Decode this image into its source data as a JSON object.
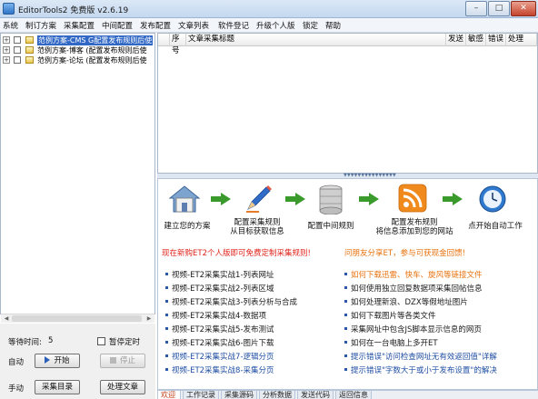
{
  "window": {
    "title": "EditorTools2 免费版 v2.6.19",
    "minimize_label": "–",
    "maximize_label": "□",
    "close_label": "✕"
  },
  "menu": [
    "系统",
    "制订方案",
    "采集配置",
    "中间配置",
    "发布配置",
    "文章列表",
    "软件登记",
    "升级个人版",
    "锁定",
    "帮助"
  ],
  "tree": {
    "items": [
      {
        "label": "范例方案-CMS G配置发布规则后使",
        "selected": true
      },
      {
        "label": "范例方案-博客 (配置发布规则后使",
        "selected": false
      },
      {
        "label": "范例方案-论坛 (配置发布规则后使",
        "selected": false
      }
    ],
    "expander": "+",
    "scroll_left": "◀",
    "scroll_right": "▶"
  },
  "controls": {
    "wait_label": "等待时间:",
    "wait_value": "5",
    "pause_label": "暂停定时",
    "auto_label": "自动",
    "start_label": "开始",
    "stop_label": "停止",
    "manual_label": "手动",
    "collect_list_label": "采集目录",
    "process_articles_label": "处理文章"
  },
  "grid": {
    "columns": [
      "序号",
      "文章采集标题",
      "发送",
      "敏感",
      "错误",
      "处理"
    ]
  },
  "splitter": {
    "grip": "▼▼▼▼▼▼▼▼▼▼▼▼▼▼▼"
  },
  "welcome": {
    "steps": [
      {
        "label_lines": [
          "建立您的方案"
        ],
        "icon": "house-icon"
      },
      {
        "label_lines": [
          "配置采集规则",
          "从目标获取信息"
        ],
        "icon": "pencil-icon"
      },
      {
        "label_lines": [
          "配置中间规则"
        ],
        "icon": "database-icon"
      },
      {
        "label_lines": [
          "配置发布规则",
          "将信息添加到您的网站"
        ],
        "icon": "rss-icon"
      },
      {
        "label_lines": [
          "点开始自动工作"
        ],
        "icon": "clock-icon"
      }
    ],
    "left_headline": "现在新购ET2个人版即可免费定制采集规则!",
    "right_headline": "问朋友分享ET，参与可获现金回馈!",
    "left_links": [
      "视频-ET2采集实战1-列表网址",
      "视频-ET2采集实战2-列表区域",
      "视频-ET2采集实战3-列表分析与合成",
      "视频-ET2采集实战4-数据项",
      "视频-ET2采集实战5-发布测试",
      "视频-ET2采集实战6-图片下载",
      "视频-ET2采集实战7-逻辑分页",
      "视频-ET2采集实战8-采集分页"
    ],
    "right_links": [
      "如何下载迅雷、快车、旋风等链接文件",
      "如何使用独立回复数据项采集回帖信息",
      "如何处理新浪、DZX等假地址图片",
      "如何下载图片等各类文件",
      "采集网址中包含JS脚本显示信息的网页",
      "如何在一台电脑上多开ET",
      "提示错误\"访问检查网址无有效返回值\"详解",
      "提示错误\"字数大于或小于发布设置\"的解决"
    ]
  },
  "tabs": [
    "欢迎",
    "工作记录",
    "采集源码",
    "分析数据",
    "发送代码",
    "返回信息"
  ],
  "colors": {
    "accent": "#3168c5",
    "headline_red": "#e0231b",
    "headline_orange": "#e8720e",
    "link_blue": "#1f4ea3",
    "arrow_green": "#3a9a2c"
  }
}
